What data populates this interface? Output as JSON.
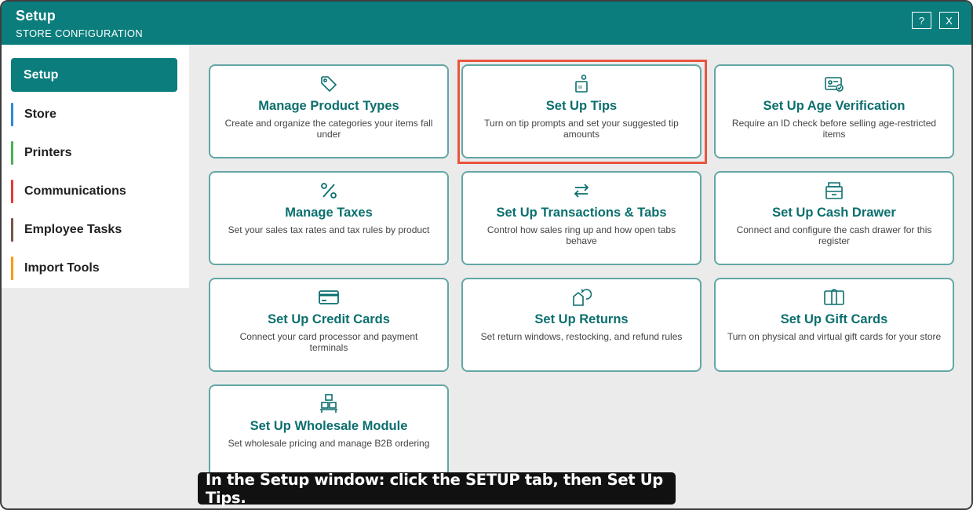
{
  "window": {
    "title": "Setup",
    "subtitle": "STORE CONFIGURATION",
    "help_label": "?",
    "close_label": "X"
  },
  "sidebar": {
    "items": [
      {
        "label": "Setup",
        "active": true
      },
      {
        "label": "Store",
        "color": "#2e8ad8"
      },
      {
        "label": "Printers",
        "color": "#4caf50"
      },
      {
        "label": "Communications",
        "color": "#e53935"
      },
      {
        "label": "Employee Tasks",
        "color": "#795548"
      },
      {
        "label": "Import Tools",
        "color": "#ff9800"
      }
    ]
  },
  "cards": [
    {
      "icon": "tag-icon",
      "title": "Manage Product Types",
      "desc": "Create and organize the categories your items fall under"
    },
    {
      "icon": "tip-jar-icon",
      "title": "Set Up Tips",
      "desc": "Turn on tip prompts and set your suggested tip amounts"
    },
    {
      "icon": "id-card-check-icon",
      "title": "Set Up Age Verification",
      "desc": "Require an ID check before selling age-restricted items"
    },
    {
      "icon": "percent-icon",
      "title": "Manage Taxes",
      "desc": "Set your sales tax rates and tax rules by product"
    },
    {
      "icon": "transfer-arrows-icon",
      "title": "Set Up Transactions & Tabs",
      "desc": "Control how sales ring up and how open tabs behave"
    },
    {
      "icon": "cash-drawer-icon",
      "title": "Set Up Cash Drawer",
      "desc": "Connect and configure the cash drawer for this register"
    },
    {
      "icon": "credit-card-icon",
      "title": "Set Up Credit Cards",
      "desc": "Connect your card processor and payment terminals"
    },
    {
      "icon": "return-icon",
      "title": "Set Up Returns",
      "desc": "Set return windows, restocking, and refund rules"
    },
    {
      "icon": "gift-card-icon",
      "title": "Set Up Gift Cards",
      "desc": "Turn on physical and virtual gift cards for your store"
    },
    {
      "icon": "wholesale-boxes-icon",
      "title": "Set Up Wholesale Module",
      "desc": "Set wholesale pricing and manage B2B ordering"
    }
  ],
  "caption": "In the Setup window: click the SETUP tab, then Set Up Tips.",
  "colors": {
    "accent": "#0a7d7c",
    "card_border": "#63a7a5",
    "highlight": "#e8553f"
  }
}
